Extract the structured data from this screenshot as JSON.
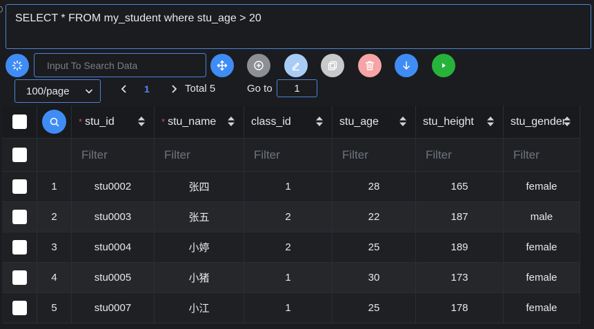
{
  "sql": {
    "query": "SELECT * FROM my_student where stu_age > 20"
  },
  "toolbar": {
    "search_placeholder": "Input To Search Data",
    "colors": {
      "blue": "#3f8cf5",
      "gray": "#8c8f94",
      "light_blue": "#a9ccf7",
      "light_gray": "#c8c9cb",
      "pink": "#f6a4a6",
      "green": "#27b33b"
    }
  },
  "pager": {
    "page_size": "100/page",
    "current_page": "1",
    "total": "Total 5",
    "goto_label": "Go to",
    "goto_value": "1"
  },
  "table": {
    "columns": [
      {
        "key": "stu_id",
        "label": "stu_id",
        "required": true
      },
      {
        "key": "stu_name",
        "label": "stu_name",
        "required": true
      },
      {
        "key": "class_id",
        "label": "class_id",
        "required": false
      },
      {
        "key": "stu_age",
        "label": "stu_age",
        "required": false
      },
      {
        "key": "stu_height",
        "label": "stu_height",
        "required": false
      },
      {
        "key": "stu_gender",
        "label": "stu_gender",
        "required": false
      }
    ],
    "filter_placeholder": "Filter",
    "required_mark": "*",
    "rows": [
      {
        "index": "1",
        "stu_id": "stu0002",
        "stu_name": "张四",
        "class_id": "1",
        "stu_age": "28",
        "stu_height": "165",
        "stu_gender": "female"
      },
      {
        "index": "2",
        "stu_id": "stu0003",
        "stu_name": "张五",
        "class_id": "2",
        "stu_age": "22",
        "stu_height": "187",
        "stu_gender": "male"
      },
      {
        "index": "3",
        "stu_id": "stu0004",
        "stu_name": "小婷",
        "class_id": "2",
        "stu_age": "25",
        "stu_height": "189",
        "stu_gender": "female"
      },
      {
        "index": "4",
        "stu_id": "stu0005",
        "stu_name": "小猪",
        "class_id": "1",
        "stu_age": "30",
        "stu_height": "173",
        "stu_gender": "female"
      },
      {
        "index": "5",
        "stu_id": "stu0007",
        "stu_name": "小江",
        "class_id": "1",
        "stu_age": "25",
        "stu_height": "178",
        "stu_gender": "female"
      }
    ]
  }
}
